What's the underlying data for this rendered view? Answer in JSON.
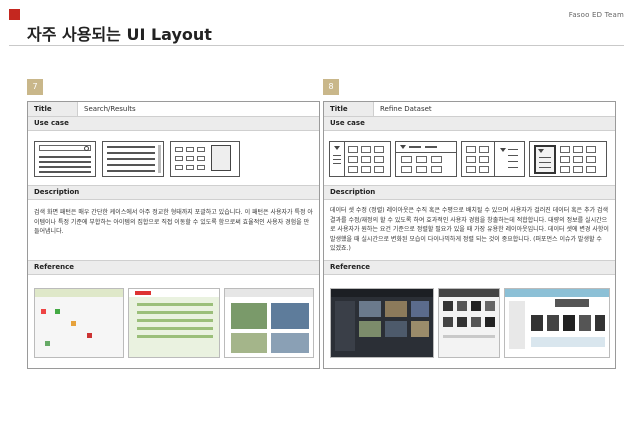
{
  "header": {
    "brand": "Fasoo ED Team",
    "page_title": "자주 사용되는 UI Layout"
  },
  "panels": [
    {
      "number": "7",
      "title_label": "Title",
      "title_value": "Search/Results",
      "usecase_label": "Use case",
      "description_label": "Description",
      "description_text": "검색 화면 패턴은 매우 간단한 케이스에서 아주 정교한 형태까지 포괄하고 있습니다. 이 패턴은 사용자가 특정 아이템이나 특정 기준에 부합하는 아이템의 집합으로 직접 이동할 수 있도록 함으로써 효율적인 사용자 경험을 만들어냅니다.",
      "reference_label": "Reference"
    },
    {
      "number": "8",
      "title_label": "Title",
      "title_value": "Refine Dataset",
      "usecase_label": "Use case",
      "description_label": "Description",
      "description_text": "데이터 셋 수정 (정렬) 레이아웃은 수직 혹은 수평으로 배치될 수 있으며 사용자가 걸러진 데이터 혹은 추가 검색 결과를 수정/재정의 할 수 있도록 하여 효과적인 사용자 경험을 창출하는데 적합합니다. 대량의 정보를 실시간으로 사용자가 원하는 요건 기준으로 정렬할 필요가 있을 때 가장 유용한 레이아웃입니다. 데이터 셋에 변경 사항이 발생했을 때 실시간으로 변화된 모습이 다이나믹하게 정렬 되는 것이 중요합니다. (퍼포먼스 이슈가 발생할 수 있겠죠.)",
      "reference_label": "Reference"
    }
  ],
  "colors": {
    "accent": "#c4271f",
    "badge": "#c9b78a",
    "section_bg": "#ececec"
  }
}
